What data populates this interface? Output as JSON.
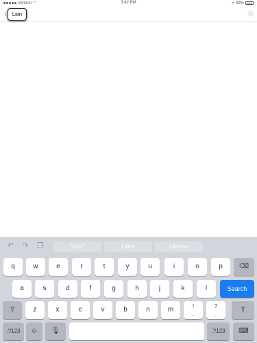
{
  "status": {
    "carrier": "Verizon",
    "time": "3:42 PM",
    "battery": "39%"
  },
  "nav": {
    "search_token": "Lion"
  },
  "keyboard": {
    "suggestions": [
      "\"Lion\"",
      "Lions",
      "Lioness"
    ],
    "row1": [
      "q",
      "w",
      "e",
      "r",
      "t",
      "y",
      "u",
      "i",
      "o",
      "p"
    ],
    "row2": [
      "a",
      "s",
      "d",
      "f",
      "g",
      "h",
      "j",
      "k",
      "l"
    ],
    "search_label": "Search",
    "row3": [
      "z",
      "x",
      "c",
      "v",
      "b",
      "n",
      "m"
    ],
    "punct": [
      {
        "top": "!",
        "bottom": ","
      },
      {
        "top": "?",
        "bottom": "."
      }
    ],
    "numbers_label": ".?123"
  }
}
